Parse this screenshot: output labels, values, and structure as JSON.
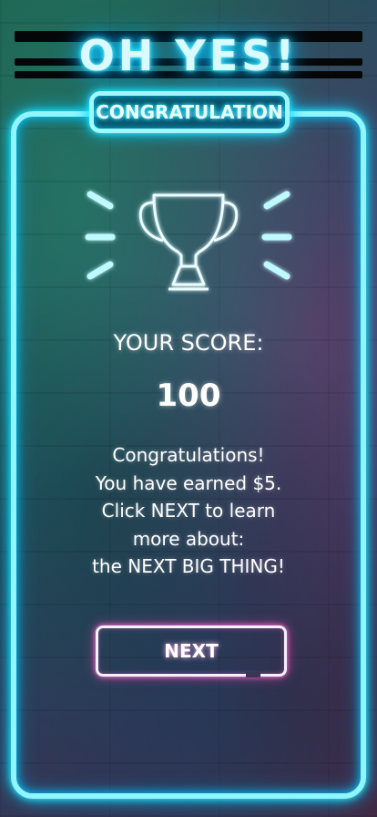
{
  "header": {
    "headline": "OH YES!",
    "banner": "CONGRATULATION"
  },
  "result": {
    "score_label": "YOUR SCORE:",
    "score_value": "100",
    "message_lines": [
      "Congratulations!",
      "You have earned $5.",
      "Click NEXT to learn",
      "more about:",
      "the NEXT BIG THING!"
    ]
  },
  "actions": {
    "next_label": "NEXT"
  },
  "icons": {
    "trophy": "trophy-icon",
    "sparkles": "sparkle-rays-icon"
  },
  "colors": {
    "neon_cyan": "#8ff6ff",
    "neon_pink": "#ff7bd8",
    "text": "#ffffff"
  }
}
